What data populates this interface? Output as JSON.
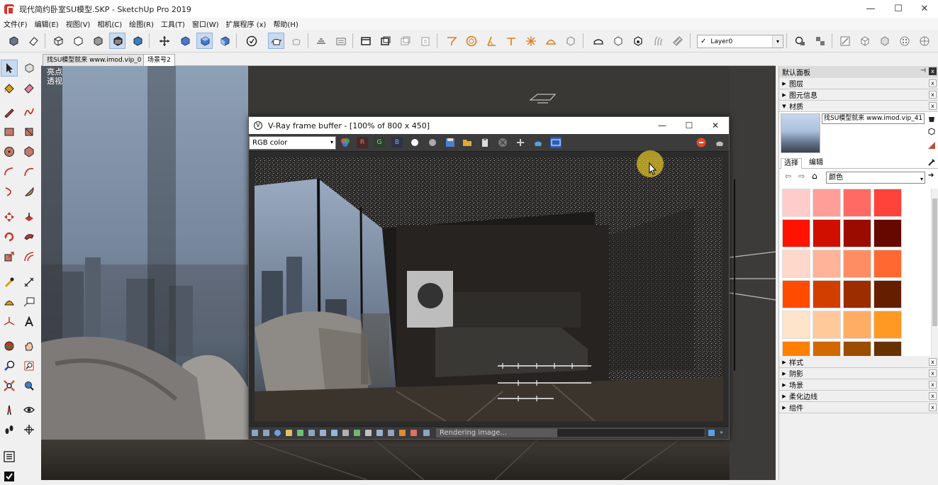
{
  "window": {
    "title": "现代简约卧室SU模型.SKP - SketchUp Pro 2019",
    "minimize": "—",
    "maximize": "☐",
    "close": "✕"
  },
  "menu": [
    "文件(F)",
    "编辑(E)",
    "视图(V)",
    "相机(C)",
    "绘图(R)",
    "工具(T)",
    "窗口(W)",
    "扩展程序 (x)",
    "帮助(H)"
  ],
  "layer": {
    "check": "✓",
    "value": "Layer0",
    "arrow": "▾"
  },
  "scene_tabs": [
    {
      "label": "找SU模型就来 www.imod.vip_0",
      "active": false
    },
    {
      "label": "场景号2",
      "active": true
    }
  ],
  "viewport": {
    "line1": "亮点",
    "line2": "透视"
  },
  "vfb": {
    "title": "V-Ray frame buffer - [100% of 800 x 450]",
    "channel": "RGB color",
    "channel_arrow": "▾",
    "r": "R",
    "g": "G",
    "b": "B",
    "status": "Rendering image...",
    "progress": 0.45,
    "minimize": "—",
    "maximize": "☐",
    "close": "✕"
  },
  "tray": {
    "title": "默认面板",
    "pin": "⊣",
    "close": "x",
    "sections_top": [
      "图层",
      "图元信息"
    ],
    "materials": {
      "label": "材质",
      "name": "找SU模型就来 www.imod.vip_41",
      "tab_select": "选择",
      "tab_edit": "编辑",
      "category": "颜色",
      "swatches": [
        "#ffcccc",
        "#ff9e99",
        "#ff6b64",
        "#ff423a",
        "#ff1200",
        "#d10f00",
        "#9b0b00",
        "#660800",
        "#ffd8cc",
        "#ffb399",
        "#ff8d64",
        "#ff6831",
        "#ff4c00",
        "#d23e00",
        "#9b2d00",
        "#661e00",
        "#ffe4cc",
        "#ffc999",
        "#ffad64",
        "#ff9924",
        "#ff8000",
        "#d16900",
        "#9b4d00",
        "#663300"
      ]
    },
    "sections_bottom": [
      "样式",
      "阴影",
      "场景",
      "柔化边线",
      "组件"
    ]
  }
}
